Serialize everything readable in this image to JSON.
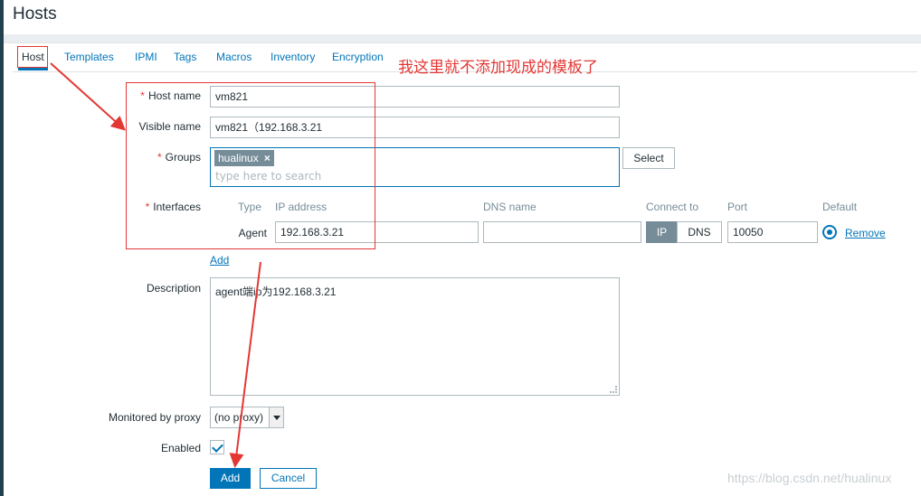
{
  "page": {
    "title": "Hosts"
  },
  "tabs": [
    {
      "label": "Host"
    },
    {
      "label": "Templates"
    },
    {
      "label": "IPMI"
    },
    {
      "label": "Tags"
    },
    {
      "label": "Macros"
    },
    {
      "label": "Inventory"
    },
    {
      "label": "Encryption"
    }
  ],
  "annotation": {
    "text": "我这里就不添加现成的模板了"
  },
  "form": {
    "required_mark": "*",
    "host_name": {
      "label": "Host name",
      "value": "vm821"
    },
    "visible_name": {
      "label": "Visible name",
      "value": "vm821（192.168.3.21"
    },
    "groups": {
      "label": "Groups",
      "tag": "hualinux",
      "tag_remove": "×",
      "placeholder": "type here to search",
      "select_button": "Select"
    },
    "interfaces": {
      "label": "Interfaces",
      "headers": {
        "type": "Type",
        "ip": "IP address",
        "dns": "DNS name",
        "connect_to": "Connect to",
        "port": "Port",
        "default": "Default"
      },
      "agent": {
        "type": "Agent",
        "ip": "192.168.3.21",
        "dns": "",
        "connect_ip": "IP",
        "connect_dns": "DNS",
        "port": "10050",
        "remove": "Remove"
      },
      "add_link": "Add"
    },
    "description": {
      "label": "Description",
      "value": "agent端ip为192.168.3.21"
    },
    "proxy": {
      "label": "Monitored by proxy",
      "value": "(no proxy)"
    },
    "enabled": {
      "label": "Enabled",
      "checked": true
    },
    "buttons": {
      "add": "Add",
      "cancel": "Cancel"
    }
  },
  "watermark": "https://blog.csdn.net/hualinux",
  "colors": {
    "accent": "#0275b8",
    "annotation": "#e33734",
    "tag_bg": "#768d99"
  }
}
